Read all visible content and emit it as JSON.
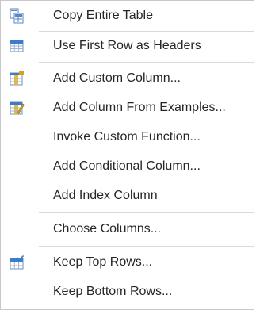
{
  "menu": {
    "items": [
      {
        "label": "Copy Entire Table",
        "icon": "copy-table-icon"
      },
      {
        "label": "Use First Row as Headers",
        "icon": "table-headers-icon"
      },
      {
        "label": "Add Custom Column...",
        "icon": "custom-column-icon"
      },
      {
        "label": "Add Column From Examples...",
        "icon": "column-from-examples-icon"
      },
      {
        "label": "Invoke Custom Function..."
      },
      {
        "label": "Add Conditional Column..."
      },
      {
        "label": "Add Index Column"
      },
      {
        "label": "Choose Columns..."
      },
      {
        "label": "Keep Top Rows...",
        "icon": "keep-top-rows-icon"
      },
      {
        "label": "Keep Bottom Rows..."
      }
    ]
  },
  "colors": {
    "icon_blue": "#3d7cc9",
    "icon_gold": "#d6a21a",
    "text": "#262626"
  }
}
